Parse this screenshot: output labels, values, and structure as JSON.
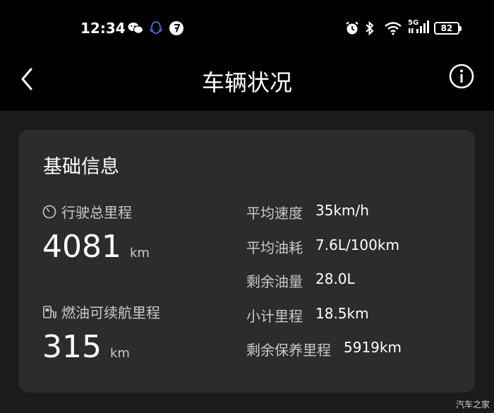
{
  "status": {
    "time": "12:34",
    "network": "5G",
    "battery": "82",
    "left_icons": [
      "wechat-icon",
      "qq-icon",
      "app-icon"
    ],
    "right_icons": [
      "alarm-icon",
      "bluetooth-icon",
      "wifi-icon",
      "signal-icon"
    ]
  },
  "appbar": {
    "title": "车辆状况"
  },
  "card": {
    "title": "基础信息",
    "odometer": {
      "label": "行驶总里程",
      "value": "4081",
      "unit": "km"
    },
    "range": {
      "label": "燃油可续航里程",
      "value": "315",
      "unit": "km"
    },
    "stats": [
      {
        "label": "平均速度",
        "value": "35km/h"
      },
      {
        "label": "平均油耗",
        "value": "7.6L/100km"
      },
      {
        "label": "剩余油量",
        "value": "28.0L"
      },
      {
        "label": "小计里程",
        "value": "18.5km"
      },
      {
        "label": "剩余保养里程",
        "value": "5919km"
      }
    ]
  },
  "watermark": "汽车之家"
}
